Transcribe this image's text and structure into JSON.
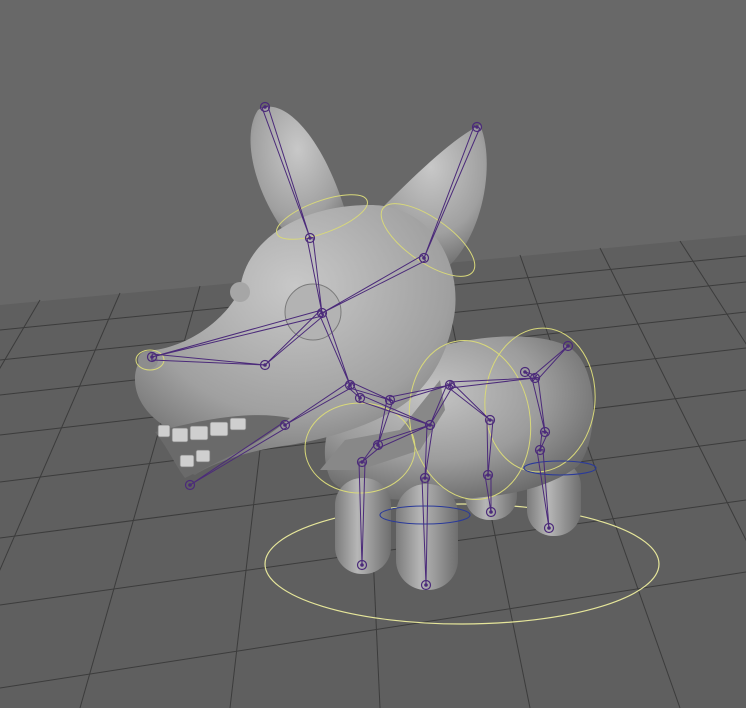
{
  "viewport": {
    "background": "#686868",
    "grid_color": "#5a5a5a",
    "grid_line_color": "#3c3c3c"
  },
  "model": {
    "body_color": "#9a9a9a",
    "joint_color": "#4b2a7a",
    "control_curve_color": "#d8d87a",
    "ground_curve_color": "#e6e69a",
    "hip_curve_color": "#2a3a9a"
  }
}
